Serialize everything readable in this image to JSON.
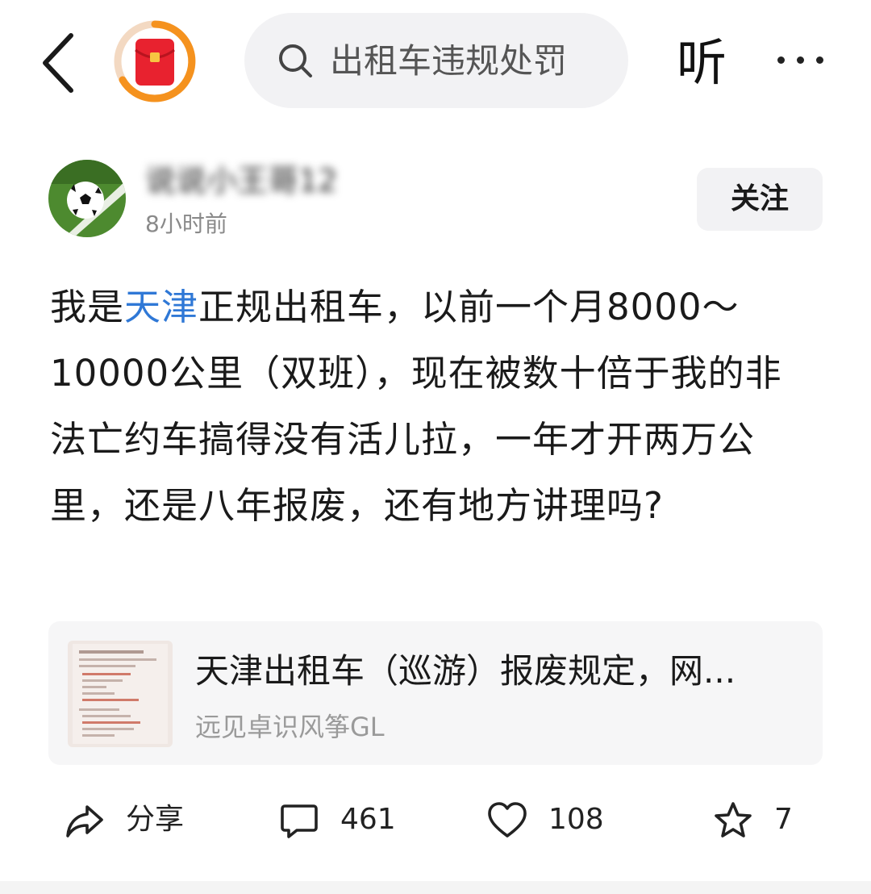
{
  "top_bar": {
    "search_text": "出租车违规处罚",
    "listen_label": "听"
  },
  "author": {
    "name": "说说小王哥12",
    "time": "8小时前",
    "follow_label": "关注"
  },
  "post": {
    "text_before": "我是",
    "topic": "天津",
    "text_after": "正规出租车，以前一个月8000～10000公里（双班），现在被数十倍于我的非法亡约车搞得没有活儿拉，一年才开两万公里，还是八年报废，还有地方讲理吗?"
  },
  "article": {
    "title": "天津出租车（巡游）报废规定，网...",
    "author": "远见卓识风筝GL"
  },
  "actions": {
    "share_label": "分享",
    "comments": "461",
    "likes": "108",
    "favorites": "7"
  },
  "colors": {
    "link": "#2f78d6",
    "hongbao_ring": "#f5921e",
    "hongbao_red": "#e8222f"
  }
}
